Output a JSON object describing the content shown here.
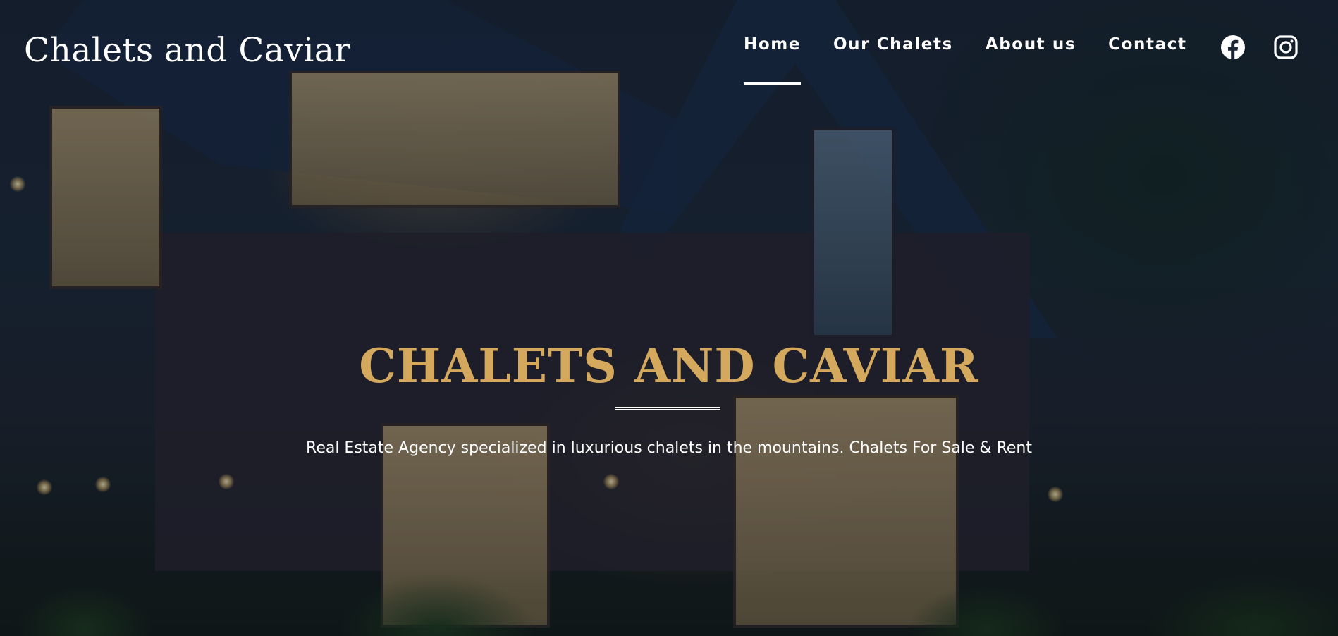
{
  "header": {
    "logo": "Chalets and Caviar",
    "nav": [
      {
        "label": "Home",
        "active": true
      },
      {
        "label": "Our Chalets",
        "active": false
      },
      {
        "label": "About us",
        "active": false
      },
      {
        "label": "Contact",
        "active": false
      }
    ],
    "social": [
      {
        "icon": "facebook-icon"
      },
      {
        "icon": "instagram-icon"
      }
    ]
  },
  "hero": {
    "title": "CHALETS AND CAVIAR",
    "subtitle": "Real Estate Agency specialized in luxurious chalets in the mountains. Chalets For Sale & Rent"
  },
  "colors": {
    "accent_gold": "#d4a85d",
    "text": "#ffffff"
  }
}
